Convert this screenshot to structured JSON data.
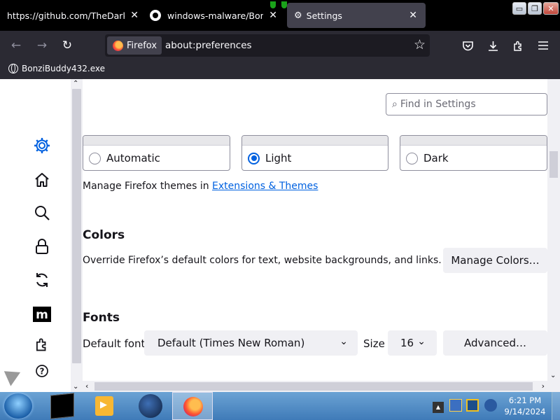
{
  "tabs": [
    {
      "title": "https://github.com/TheDarkM",
      "close": "✕"
    },
    {
      "title": "windows-malware/Bonzi",
      "close": "✕"
    },
    {
      "title": "Settings",
      "close": "✕"
    }
  ],
  "window_controls": {
    "minimize": "▭",
    "restore": "❐",
    "close": "✕"
  },
  "nav": {
    "back": "←",
    "forward": "→",
    "reload": "↻",
    "identity_label": "Firefox",
    "url": "about:preferences",
    "star": "☆"
  },
  "bookmarks": [
    {
      "label": "BonziBuddy432.exe"
    }
  ],
  "search": {
    "placeholder": "Find in Settings",
    "icon": "⌕"
  },
  "themes": {
    "options": [
      {
        "label": "Automatic",
        "checked": false
      },
      {
        "label": "Light",
        "checked": true
      },
      {
        "label": "Dark",
        "checked": false
      }
    ],
    "manage_prefix": "Manage Firefox themes in",
    "manage_link": "Extensions & Themes"
  },
  "colors": {
    "heading": "Colors",
    "description": "Override Firefox’s default colors for text, website backgrounds, and links.",
    "button": "Manage Colors…"
  },
  "fonts": {
    "heading": "Fonts",
    "default_font_label": "Default font",
    "default_font_value": "Default (Times New Roman)",
    "size_label": "Size",
    "size_value": "16",
    "advanced_button": "Advanced…"
  },
  "scroll": {
    "up": "⌃",
    "down": "⌄",
    "left": "‹",
    "right": "›"
  },
  "taskbar": {
    "time": "6:21 PM",
    "date": "9/14/2024",
    "tray_toggle": "▲"
  },
  "colors_theme": {
    "accent": "#0061e0",
    "toolbar": "#2b2a33",
    "tabstrip": "#000000"
  }
}
